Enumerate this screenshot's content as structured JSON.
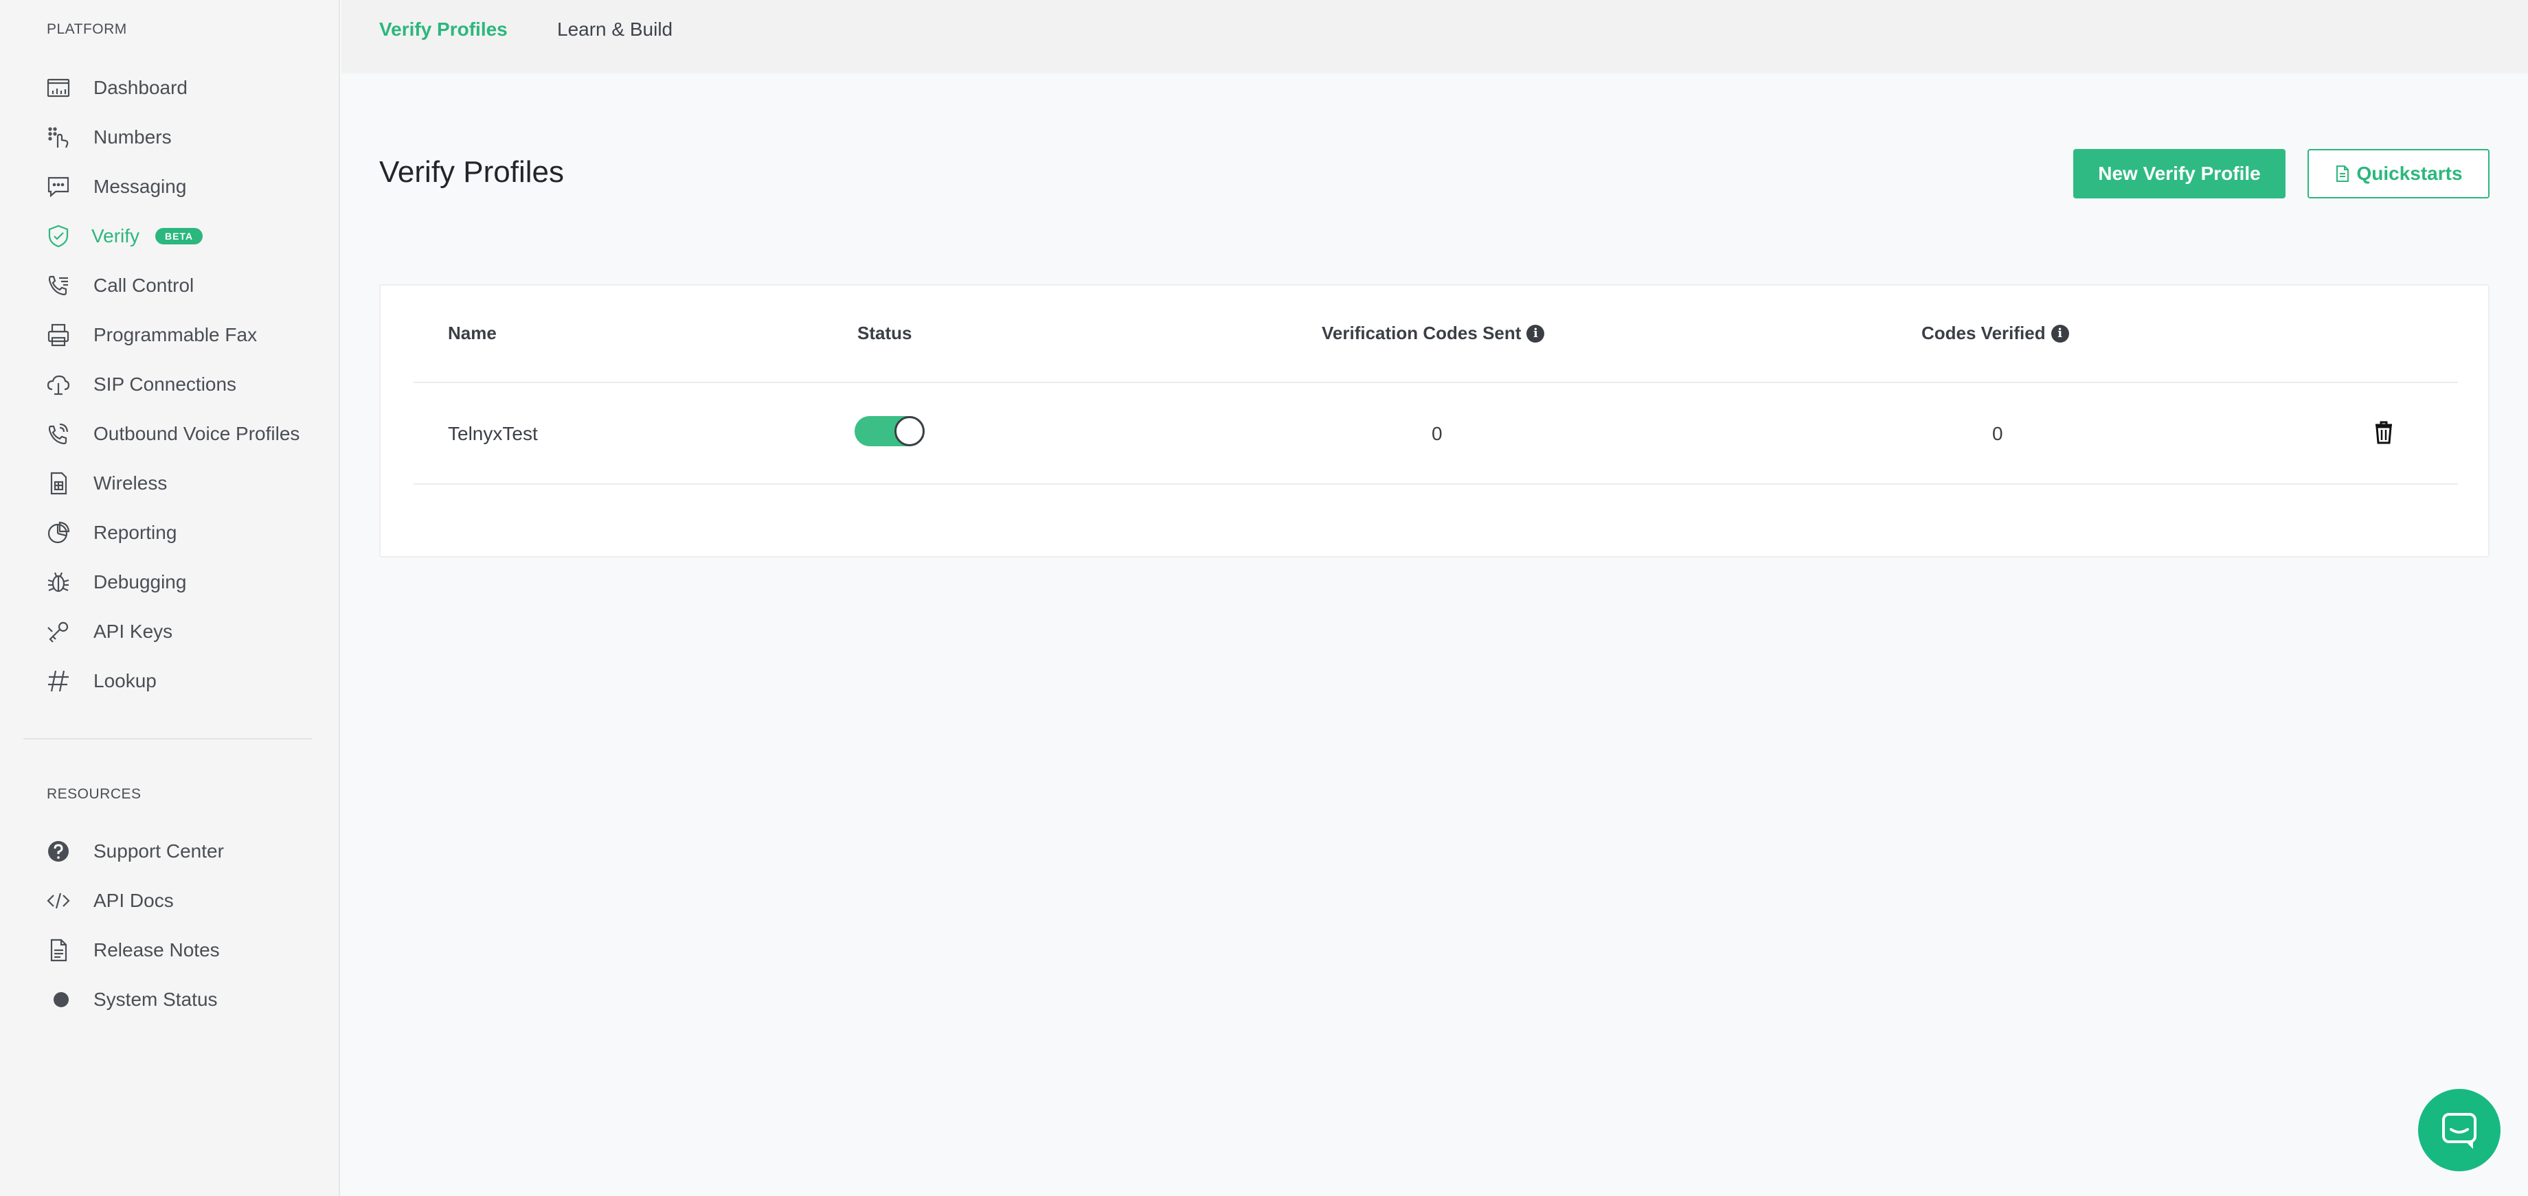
{
  "sidebar": {
    "platform_title": "PLATFORM",
    "resources_title": "RESOURCES",
    "platform_items": [
      {
        "label": "Dashboard",
        "icon": "dashboard-icon"
      },
      {
        "label": "Numbers",
        "icon": "numbers-icon"
      },
      {
        "label": "Messaging",
        "icon": "messaging-icon"
      },
      {
        "label": "Verify",
        "icon": "shield-check-icon",
        "badge": "BETA",
        "active": true
      },
      {
        "label": "Call Control",
        "icon": "call-control-icon"
      },
      {
        "label": "Programmable Fax",
        "icon": "fax-icon"
      },
      {
        "label": "SIP Connections",
        "icon": "sip-cloud-icon"
      },
      {
        "label": "Outbound Voice Profiles",
        "icon": "outbound-phone-icon"
      },
      {
        "label": "Wireless",
        "icon": "sim-card-icon"
      },
      {
        "label": "Reporting",
        "icon": "pie-chart-icon"
      },
      {
        "label": "Debugging",
        "icon": "bug-icon"
      },
      {
        "label": "API Keys",
        "icon": "key-icon"
      },
      {
        "label": "Lookup",
        "icon": "hash-icon"
      }
    ],
    "resource_items": [
      {
        "label": "Support Center",
        "icon": "question-icon"
      },
      {
        "label": "API Docs",
        "icon": "code-icon"
      },
      {
        "label": "Release Notes",
        "icon": "document-icon"
      },
      {
        "label": "System Status",
        "icon": "status-dot-icon"
      }
    ]
  },
  "tabs": [
    {
      "label": "Verify Profiles",
      "active": true
    },
    {
      "label": "Learn & Build",
      "active": false
    }
  ],
  "main": {
    "title": "Verify Profiles",
    "new_button": "New Verify Profile",
    "quickstarts_button": "Quickstarts"
  },
  "table": {
    "headers": {
      "name": "Name",
      "status": "Status",
      "codes_sent": "Verification Codes Sent",
      "codes_verified": "Codes Verified"
    },
    "rows": [
      {
        "name": "TelnyxTest",
        "status_enabled": true,
        "codes_sent": "0",
        "codes_verified": "0"
      }
    ]
  },
  "colors": {
    "accent": "#2bb77d",
    "sidebar_bg": "#f5f5f5",
    "page_bg": "#f8f9fa"
  }
}
